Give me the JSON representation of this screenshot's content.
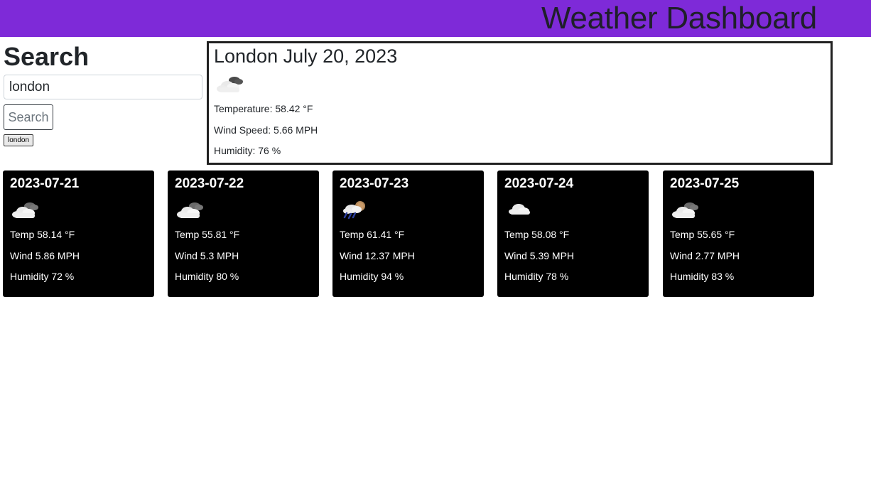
{
  "header": {
    "title": "Weather Dashboard"
  },
  "search": {
    "heading": "Search",
    "input_value": "london",
    "button_label": "Search",
    "history": [
      "london"
    ]
  },
  "current": {
    "title": "London July 20, 2023",
    "icon": "partly-cloudy-icon",
    "temperature": "Temperature: 58.42 °F",
    "wind": "Wind Speed: 5.66 MPH",
    "humidity": "Humidity: 76 %"
  },
  "forecast": [
    {
      "date": "2023-07-21",
      "icon": "partly-cloudy-icon",
      "temp": "Temp 58.14 °F",
      "wind": "Wind 5.86 MPH",
      "humidity": "Humidity 72 %"
    },
    {
      "date": "2023-07-22",
      "icon": "partly-cloudy-icon",
      "temp": "Temp 55.81 °F",
      "wind": "Wind 5.3 MPH",
      "humidity": "Humidity 80 %"
    },
    {
      "date": "2023-07-23",
      "icon": "rain-icon",
      "temp": "Temp 61.41 °F",
      "wind": "Wind 12.37 MPH",
      "humidity": "Humidity 94 %"
    },
    {
      "date": "2023-07-24",
      "icon": "cloud-icon",
      "temp": "Temp 58.08 °F",
      "wind": "Wind 5.39 MPH",
      "humidity": "Humidity 78 %"
    },
    {
      "date": "2023-07-25",
      "icon": "partly-cloudy-icon",
      "temp": "Temp 55.65 °F",
      "wind": "Wind 2.77 MPH",
      "humidity": "Humidity 83 %"
    }
  ]
}
